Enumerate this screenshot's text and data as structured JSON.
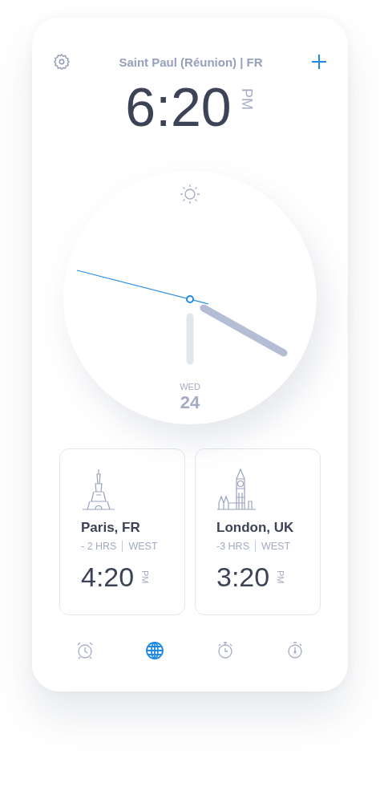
{
  "header": {
    "location": "Saint Paul (Réunion) | FR"
  },
  "current": {
    "time": "6:20",
    "meridiem": "PM",
    "weekday": "WED",
    "day": "24"
  },
  "cities": [
    {
      "kind": "eiffel",
      "name": "Paris, FR",
      "offset": "- 2 HRS",
      "direction": "WEST",
      "time": "4:20",
      "meridiem": "PM"
    },
    {
      "kind": "bigben",
      "name": "London, UK",
      "offset": "-3 HRS",
      "direction": "WEST",
      "time": "3:20",
      "meridiem": "PM"
    }
  ],
  "tabs": [
    {
      "kind": "alarm",
      "selected": false
    },
    {
      "kind": "world",
      "selected": true
    },
    {
      "kind": "timer",
      "selected": false
    },
    {
      "kind": "stopwatch",
      "selected": false
    }
  ]
}
